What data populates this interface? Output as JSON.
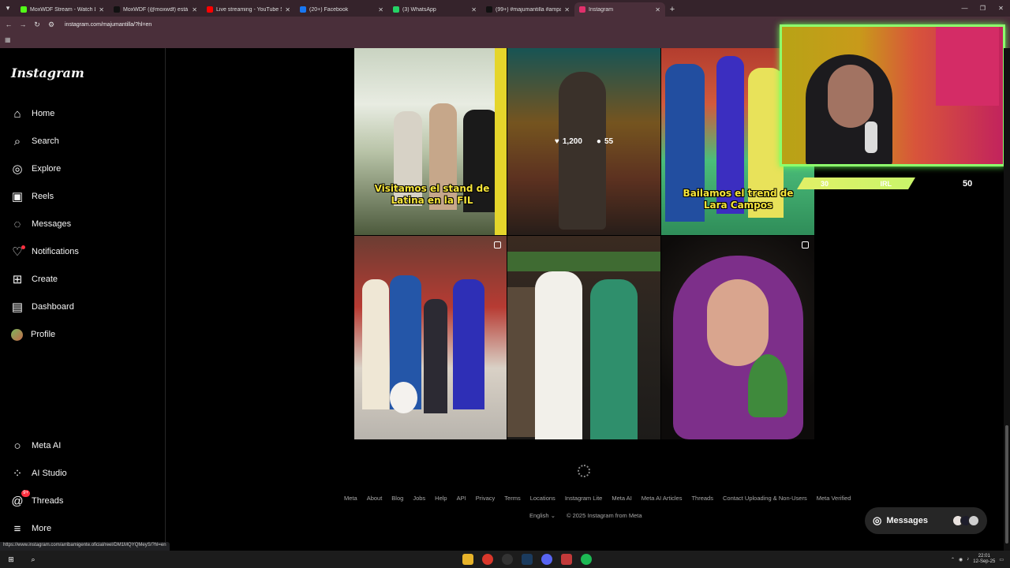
{
  "browser": {
    "tabs": [
      {
        "label": "MoxWDF Stream - Watch Live",
        "color": "#53fc18",
        "active": false
      },
      {
        "label": "MoxWDF (@moxwdf) está en",
        "color": "#111111",
        "active": false
      },
      {
        "label": "Live streaming - YouTube Studio",
        "color": "#ff0000",
        "active": false
      },
      {
        "label": "(20+) Facebook",
        "color": "#1877f2",
        "active": false
      },
      {
        "label": "(3) WhatsApp",
        "color": "#25d366",
        "active": false
      },
      {
        "label": "(99+) #majumantilla #ampay #",
        "color": "#111111",
        "active": false
      },
      {
        "label": "Instagram",
        "color": "#e1306c",
        "active": true
      }
    ],
    "url": "instagram.com/majumantilla/?hl=en",
    "status_url": "https://www.instagram.com/arribamigente.oficial/reel/DM1MQYQMeyS/?hl=en"
  },
  "sidebar": {
    "logo": "Instagram",
    "items": [
      {
        "label": "Home",
        "icon": "home-icon"
      },
      {
        "label": "Search",
        "icon": "search-icon"
      },
      {
        "label": "Explore",
        "icon": "compass-icon"
      },
      {
        "label": "Reels",
        "icon": "reels-icon"
      },
      {
        "label": "Messages",
        "icon": "messenger-icon"
      },
      {
        "label": "Notifications",
        "icon": "heart-icon"
      },
      {
        "label": "Create",
        "icon": "plus-square-icon"
      },
      {
        "label": "Dashboard",
        "icon": "chart-icon"
      },
      {
        "label": "Profile",
        "icon": "avatar"
      }
    ],
    "bottom_items": [
      {
        "label": "Meta AI",
        "icon": "meta-ai-icon"
      },
      {
        "label": "AI Studio",
        "icon": "ai-studio-icon"
      },
      {
        "label": "Threads",
        "icon": "threads-icon",
        "badge": "9+"
      },
      {
        "label": "More",
        "icon": "menu-icon"
      }
    ]
  },
  "posts": [
    {
      "caption": "Visitamos el stand de Latina en la FIL"
    },
    {
      "likes": "1,200",
      "comments": "55"
    },
    {
      "caption": "Bailamos el trend de Lara Campos"
    },
    {},
    {},
    {}
  ],
  "overlay_hud": {
    "left": "30",
    "mid": "IRL",
    "right": "50"
  },
  "footer": {
    "links": [
      "Meta",
      "About",
      "Blog",
      "Jobs",
      "Help",
      "API",
      "Privacy",
      "Terms",
      "Locations",
      "Instagram Lite",
      "Meta AI",
      "Meta AI Articles",
      "Threads",
      "Contact Uploading & Non-Users",
      "Meta Verified"
    ],
    "language": "English",
    "copyright": "© 2025 Instagram from Meta"
  },
  "messages_pill": {
    "label": "Messages"
  },
  "taskbar": {
    "time": "22:01",
    "date": "12-Sep-25"
  }
}
